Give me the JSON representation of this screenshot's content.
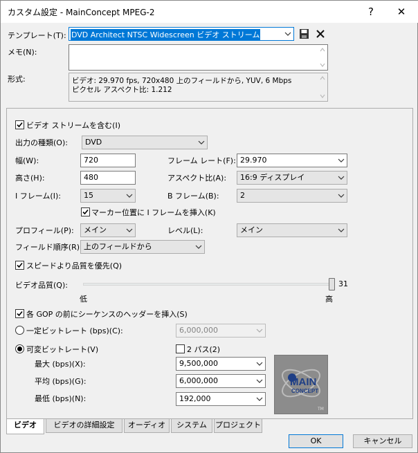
{
  "window": {
    "title": "カスタム設定 - MainConcept MPEG-2",
    "help": "?",
    "close": "✕"
  },
  "template": {
    "label": "テンプレート(T):",
    "value": "DVD Architect NTSC Widescreen ビデオ ストリーム"
  },
  "memo": {
    "label": "メモ(N):",
    "value": ""
  },
  "format": {
    "label": "形式:",
    "line1": "ビデオ: 29.970 fps, 720x480 上のフィールドから, YUV, 6 Mbps",
    "line2": "ピクセル アスペクト比: 1.212"
  },
  "video": {
    "include_stream": "ビデオ ストリームを含む(I)",
    "output_type_label": "出力の種類(O):",
    "output_type": "DVD",
    "width_label": "幅(W):",
    "width": "720",
    "height_label": "高さ(H):",
    "height": "480",
    "framerate_label": "フレーム レート(F):",
    "framerate": "29.970",
    "aspect_label": "アスペクト比(A):",
    "aspect": "16:9 ディスプレイ",
    "iframe_label": "I フレーム(I):",
    "iframe": "15",
    "bframe_label": "B フレーム(B):",
    "bframe": "2",
    "marker_iframe": "マーカー位置に I フレームを挿入(K)",
    "profile_label": "プロフィール(P):",
    "profile": "メイン",
    "level_label": "レベル(L):",
    "level": "メイン",
    "field_order_label": "フィールド順序(R):",
    "field_order": "上のフィールドから",
    "quality_over_speed": "スピードより品質を優先(Q)",
    "quality_label": "ビデオ品質(Q):",
    "quality_value": "31",
    "quality_low": "低",
    "quality_high": "高",
    "quality_level": 1.0,
    "gop_header": "各 GOP の前にシーケンスのヘッダーを挿入(S)",
    "cbr_label": "一定ビットレート (bps)(C):",
    "cbr_value": "6,000,000",
    "vbr_label": "可変ビットレート(V)",
    "two_pass": "2 パス(2)",
    "max_label": "最大 (bps)(X):",
    "max_value": "9,500,000",
    "avg_label": "平均 (bps)(G):",
    "avg_value": "6,000,000",
    "min_label": "最低 (bps)(N):",
    "min_value": "192,000"
  },
  "logo": {
    "main": "MAIN",
    "sub": "CONCEPT",
    "tm": "TM"
  },
  "tabs": [
    "ビデオ",
    "ビデオの詳細設定",
    "オーディオ",
    "システム",
    "プロジェクト"
  ],
  "buttons": {
    "ok": "OK",
    "cancel": "キャンセル"
  },
  "icons": {
    "save": "save-icon",
    "delete": "delete-icon",
    "chevron": "chevron-down-icon"
  },
  "colors": {
    "accent": "#0078d7",
    "selection": "#0078d7"
  }
}
